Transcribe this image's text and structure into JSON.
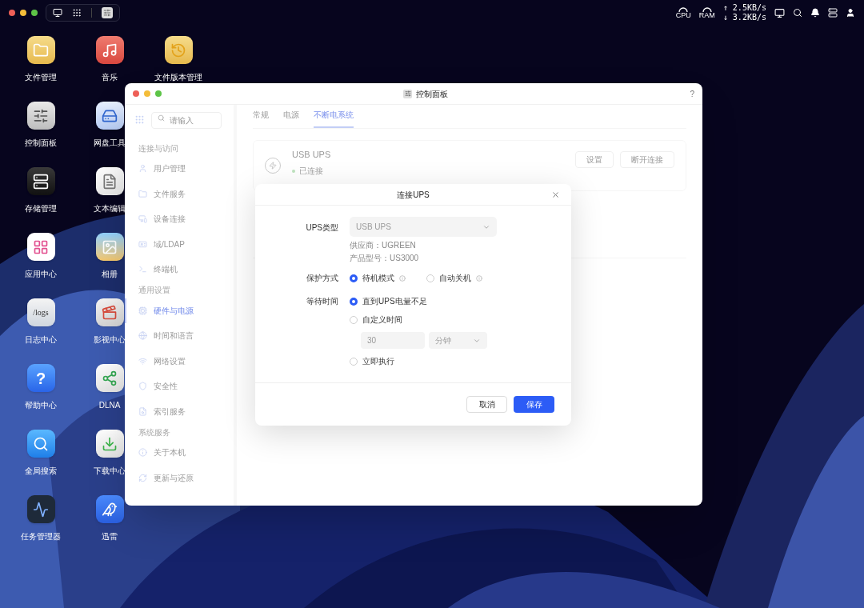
{
  "menubar": {
    "cpu_label": "CPU",
    "ram_label": "RAM",
    "upload": "↑ 2.5KB/s",
    "download": "↓ 3.2KB/s"
  },
  "desktop_columns": [
    {
      "items": [
        {
          "label": "文件管理",
          "kind": "folder"
        },
        {
          "label": "控制面板",
          "kind": "control"
        },
        {
          "label": "存储管理",
          "kind": "storage"
        },
        {
          "label": "应用中心",
          "kind": "apps"
        },
        {
          "label": "日志中心",
          "kind": "logs",
          "icon_text": "/logs"
        },
        {
          "label": "帮助中心",
          "kind": "help",
          "icon_text": "?"
        },
        {
          "label": "全局搜索",
          "kind": "search"
        },
        {
          "label": "任务管理器",
          "kind": "tasks"
        }
      ]
    },
    {
      "items": [
        {
          "label": "音乐",
          "kind": "music"
        },
        {
          "label": "网盘工具",
          "kind": "drive"
        },
        {
          "label": "文本编辑",
          "kind": "text"
        },
        {
          "label": "相册",
          "kind": "photos"
        },
        {
          "label": "影视中心",
          "kind": "video"
        },
        {
          "label": "DLNA",
          "kind": "dlna"
        },
        {
          "label": "下载中心",
          "kind": "download"
        },
        {
          "label": "迅雷",
          "kind": "bird"
        }
      ]
    },
    {
      "items": [
        {
          "label": "文件版本管理",
          "kind": "versions"
        }
      ]
    }
  ],
  "window": {
    "title": "控制面板",
    "help": "?",
    "search": {
      "placeholder": "请输入"
    },
    "sidebar": [
      {
        "heading": "连接与访问",
        "items": [
          {
            "label": "用户管理",
            "kind": "user",
            "selected": false
          },
          {
            "label": "文件服务",
            "kind": "folder",
            "selected": false
          },
          {
            "label": "设备连接",
            "kind": "device",
            "selected": false
          },
          {
            "label": "域/LDAP",
            "kind": "id",
            "selected": false
          },
          {
            "label": "终端机",
            "kind": "terminal",
            "selected": false
          }
        ]
      },
      {
        "heading": "通用设置",
        "items": [
          {
            "label": "硬件与电源",
            "kind": "hardware",
            "selected": true
          },
          {
            "label": "时间和语言",
            "kind": "globe",
            "selected": false
          },
          {
            "label": "网络设置",
            "kind": "network",
            "selected": false
          },
          {
            "label": "安全性",
            "kind": "shield",
            "selected": false
          },
          {
            "label": "索引服务",
            "kind": "index",
            "selected": false
          }
        ]
      },
      {
        "heading": "系统服务",
        "items": [
          {
            "label": "关于本机",
            "kind": "info",
            "selected": false
          },
          {
            "label": "更新与还原",
            "kind": "update",
            "selected": false
          }
        ]
      }
    ],
    "tabs": [
      {
        "label": "常规",
        "selected": false
      },
      {
        "label": "电源",
        "selected": false
      },
      {
        "label": "不断电系统",
        "selected": true
      }
    ],
    "ups": {
      "name": "USB UPS",
      "status": "已连接",
      "connected": true,
      "buttons": [
        "设置",
        "断开连接"
      ]
    }
  },
  "dialog": {
    "title": "连接UPS",
    "ups_type": {
      "label": "UPS类型",
      "value": "USB UPS",
      "vendor": "供应商：UGREEN",
      "model": "产品型号：US3000"
    },
    "protection": {
      "label": "保护方式",
      "options": [
        {
          "label": "待机模式",
          "selected": true
        },
        {
          "label": "自动关机",
          "selected": false
        }
      ]
    },
    "wait": {
      "label": "等待时间",
      "options": [
        {
          "label": "直到UPS电量不足",
          "selected": true,
          "kind": "plain"
        },
        {
          "label": "自定义时间",
          "selected": false,
          "kind": "custom"
        },
        {
          "label": "立即执行",
          "selected": false,
          "kind": "plain"
        }
      ],
      "minutes": "30",
      "unit": "分钟"
    },
    "buttons": {
      "cancel": "取消",
      "save": "保存"
    }
  }
}
